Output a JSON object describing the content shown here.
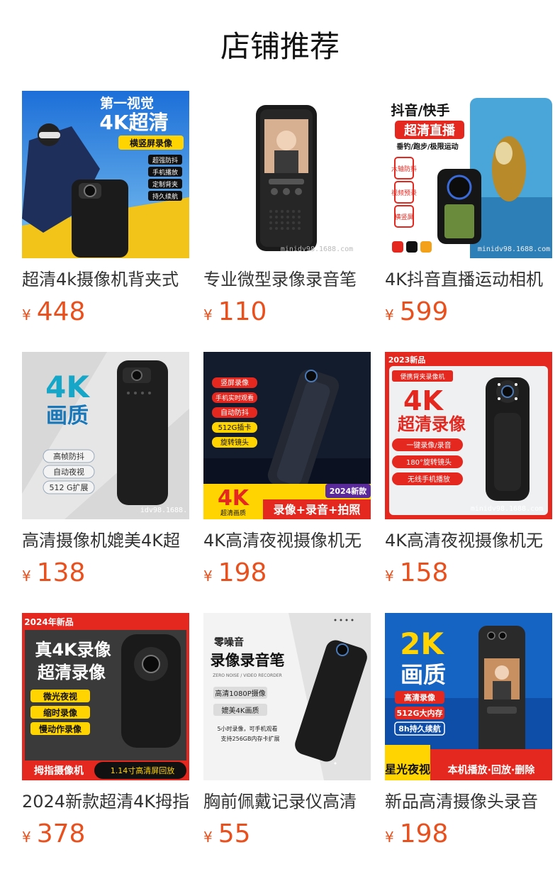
{
  "page": {
    "title": "店铺推荐"
  },
  "colors": {
    "price": "#e8501e",
    "text": "#333333",
    "title": "#111111"
  },
  "products": [
    {
      "name": "超清4k摄像机背夹式",
      "currency": "¥",
      "price": "448",
      "image": {
        "headline": "第一视觉",
        "headline2": "4K超清",
        "badge": "横竖屏录像",
        "features": [
          "超强防抖",
          "手机播放",
          "定制背夹",
          "持久续航"
        ]
      }
    },
    {
      "name": "专业微型录像录音笔",
      "currency": "¥",
      "price": "110",
      "image": {
        "watermark": "minidv98.1688.com"
      }
    },
    {
      "name": "4K抖音直播运动相机",
      "currency": "¥",
      "price": "599",
      "image": {
        "headline": "抖音/快手",
        "badge": "超清直播",
        "subline": "垂钓/跑步/极限运动",
        "features": [
          "六轴防抖",
          "视频预录",
          "横竖屏"
        ],
        "watermark": "minidv98.1688.com"
      }
    },
    {
      "name": "高清摄像机媲美4K超",
      "currency": "¥",
      "price": "138",
      "image": {
        "headline": "4K",
        "headline2": "画质",
        "features": [
          "高帧防抖",
          "自动夜视",
          "512 G扩展"
        ],
        "watermark": "idv98.1688."
      }
    },
    {
      "name": "4K高清夜视摄像机无",
      "currency": "¥",
      "price": "198",
      "image": {
        "features": [
          "竖屏录像",
          "手机实时观看",
          "自动防抖",
          "512G插卡",
          "旋转镜头"
        ],
        "badge": "2024新款",
        "headline": "4K",
        "subline": "超清画质",
        "banner": "录像+录音+拍照"
      }
    },
    {
      "name": "4K高清夜视摄像机无",
      "currency": "¥",
      "price": "158",
      "image": {
        "corner": "2023新品",
        "badge": "便携背夹录像机",
        "headline": "4K",
        "headline2": "超清录像",
        "features": [
          "一键录像/录音",
          "180°旋转镜头",
          "无线手机播放"
        ],
        "watermark": "minidv98.1688.com"
      }
    },
    {
      "name": "2024新款超清4K拇指",
      "currency": "¥",
      "price": "378",
      "image": {
        "corner": "2024年新品",
        "headline": "真4K录像",
        "headline2": "超清录像",
        "features": [
          "微光夜视",
          "缩时录像",
          "慢动作录像"
        ],
        "banner": "拇指摄像机",
        "banner2": "1.14寸高清屏回放"
      }
    },
    {
      "name": "胸前佩戴记录仪高清",
      "currency": "¥",
      "price": "55",
      "image": {
        "headline": "零噪音",
        "headline2": "录像录音笔",
        "subline": "ZERO NOISE / VIDEO RECORDER",
        "features": [
          "高清1080P摄像",
          "媲美4K画质"
        ],
        "notes": [
          "5小时录像，可手机观看",
          "支持256GB内存卡扩展"
        ]
      }
    },
    {
      "name": "新品高清摄像头录音",
      "currency": "¥",
      "price": "198",
      "image": {
        "headline": "2K",
        "headline2": "画质",
        "features": [
          "高清录像",
          "512G大内存",
          "8h持久续航"
        ],
        "corner": "星光夜视",
        "banner": "本机播放·回放·删除"
      }
    }
  ]
}
